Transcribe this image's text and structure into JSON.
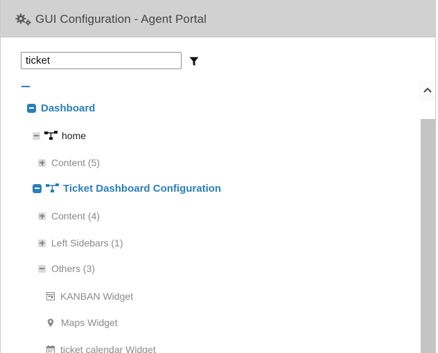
{
  "header": {
    "title": "GUI Configuration - Agent Portal",
    "icon": "gears-icon"
  },
  "search": {
    "value": "ticket",
    "placeholder": ""
  },
  "tree": {
    "dashboard": "Dashboard",
    "home": "home",
    "home_content": "Content (5)",
    "ticket_dashboard": "Ticket Dashboard Configuration",
    "td_content": "Content (4)",
    "td_left_sidebars": "Left Sidebars (1)",
    "td_others": "Others (3)",
    "widgets": [
      "KANBAN Widget",
      "Maps Widget",
      "ticket calendar Widget"
    ]
  },
  "colors": {
    "header_bg": "#d1d1d1",
    "accent": "#2a7fb8",
    "scroll_track": "#c4c4c4"
  }
}
